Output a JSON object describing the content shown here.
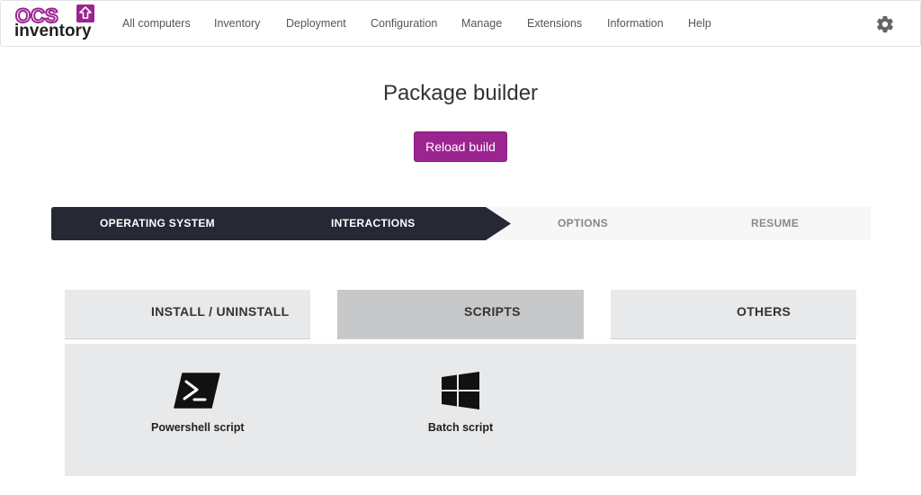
{
  "app": {
    "logo_top": "OCS",
    "logo_bottom": "inventory"
  },
  "nav": {
    "items": [
      {
        "label": "All computers"
      },
      {
        "label": "Inventory"
      },
      {
        "label": "Deployment"
      },
      {
        "label": "Configuration"
      },
      {
        "label": "Manage"
      },
      {
        "label": "Extensions"
      },
      {
        "label": "Information"
      },
      {
        "label": "Help"
      }
    ],
    "settings_icon": "gear-icon"
  },
  "page": {
    "title": "Package builder",
    "reload_label": "Reload build"
  },
  "steps": [
    {
      "label": "OPERATING SYSTEM",
      "state": "done"
    },
    {
      "label": "INTERACTIONS",
      "state": "current"
    },
    {
      "label": "OPTIONS",
      "state": "todo"
    },
    {
      "label": "RESUME",
      "state": "todo"
    }
  ],
  "tabs": [
    {
      "label": "INSTALL / UNINSTALL",
      "active": false
    },
    {
      "label": "SCRIPTS",
      "active": true
    },
    {
      "label": "OTHERS",
      "active": false
    }
  ],
  "options": [
    {
      "label": "Powershell script",
      "icon": "powershell-icon"
    },
    {
      "label": "Batch script",
      "icon": "windows-icon"
    }
  ],
  "colors": {
    "brand": "#9c2490",
    "step_active": "#262833",
    "tab_active": "#c7c8ca",
    "panel": "#e8e9ea"
  }
}
